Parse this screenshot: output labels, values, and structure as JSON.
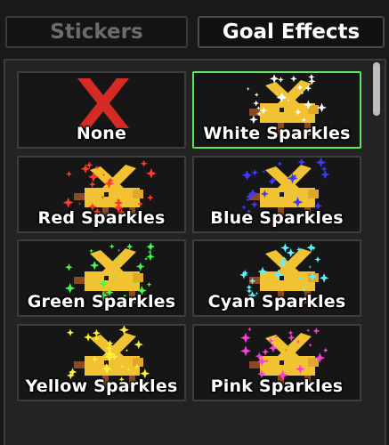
{
  "tabs": {
    "stickers": "Stickers",
    "goal_effects": "Goal Effects"
  },
  "effects": [
    {
      "label": "None",
      "color": "#d62b24",
      "selected": false,
      "icon": "red-x-icon"
    },
    {
      "label": "White Sparkles",
      "color": "#ffffff",
      "selected": true,
      "icon": "goal-creature-icon"
    },
    {
      "label": "Red Sparkles",
      "color": "#ff3a2a",
      "selected": false,
      "icon": "goal-creature-icon"
    },
    {
      "label": "Blue Sparkles",
      "color": "#3a3aff",
      "selected": false,
      "icon": "goal-creature-icon"
    },
    {
      "label": "Green Sparkles",
      "color": "#3dff4a",
      "selected": false,
      "icon": "goal-creature-icon"
    },
    {
      "label": "Cyan Sparkles",
      "color": "#5ef2ff",
      "selected": false,
      "icon": "goal-creature-icon"
    },
    {
      "label": "Yellow Sparkles",
      "color": "#fff23a",
      "selected": false,
      "icon": "goal-creature-icon"
    },
    {
      "label": "Pink Sparkles",
      "color": "#ff3adf",
      "selected": false,
      "icon": "goal-creature-icon"
    }
  ],
  "colors": {
    "selected_border": "#5ee65e",
    "creature_yellow": "#f1c232",
    "creature_brown": "#8b4a22"
  }
}
